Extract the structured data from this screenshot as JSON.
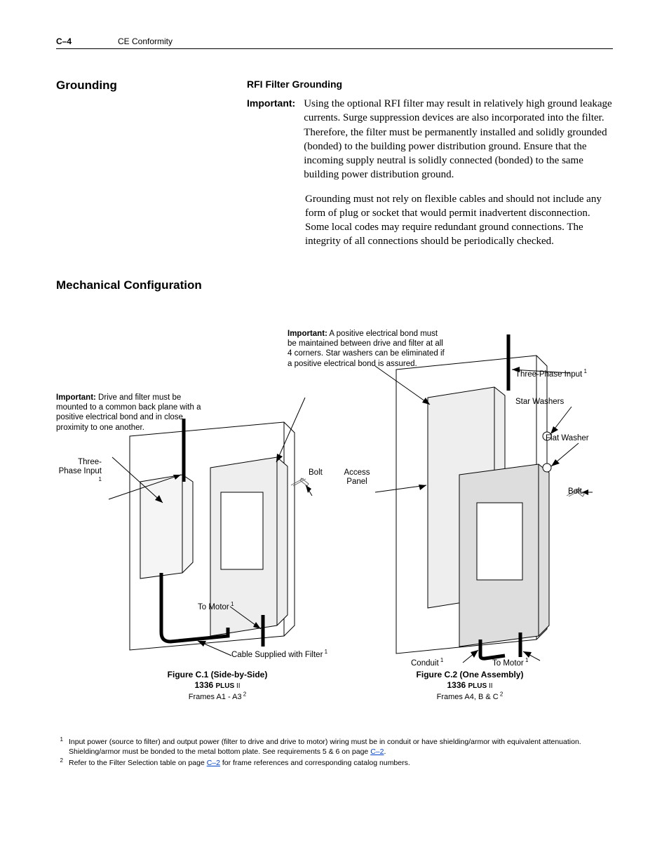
{
  "header": {
    "page_num": "C–4",
    "chapter": "CE Conformity"
  },
  "grounding": {
    "title": "Grounding",
    "subtitle": "RFI Filter Grounding",
    "important_label": "Important:",
    "important_text": "Using the optional RFI filter may result in relatively high ground leakage currents. Surge suppression devices are also incorporated into the filter. Therefore, the filter must be permanently installed and solidly grounded (bonded) to the building power distribution ground. Ensure that the incoming supply neutral is solidly connected (bonded) to the same building power distribution ground.",
    "para2": "Grounding must not rely on flexible cables and should not include any form of plug or socket that would permit inadvertent disconnection. Some local codes may require redundant ground connections. The integrity of all connections should be periodically checked."
  },
  "mechanical": {
    "title": "Mechanical Configuration",
    "note_left_label": "Important:",
    "note_left_text": " Drive and filter must be mounted to a common back plane with a positive electrical bond and in close proximity to one another.",
    "note_top_label": "Important:",
    "note_top_text": " A positive electrical bond must be maintained between drive and filter at all 4 corners. Star washers can be eliminated if a positive electrical bond is assured.",
    "labels": {
      "three_phase_left": "Three-Phase Input",
      "bolt_left": "Bolt",
      "to_motor_left": "To Motor",
      "cable_supplied": "Cable Supplied with Filter",
      "access_panel": "Access Panel",
      "three_phase_right": "Three-Phase Input",
      "star_washers": "Star Washers",
      "flat_washer": "Flat Washer",
      "bolt_right": "Bolt",
      "conduit": "Conduit",
      "to_motor_right": "To Motor"
    },
    "fig1": {
      "line1": "Figure C.1 (Side-by-Side)",
      "line2a": "1336 ",
      "line2b": "PLUS",
      "line2c": " II",
      "line3": "Frames A1 - A3"
    },
    "fig2": {
      "line1": "Figure C.2 (One Assembly)",
      "line2a": "1336 ",
      "line2b": "PLUS",
      "line2c": " II",
      "line3": "Frames A4, B & C"
    }
  },
  "footnotes": {
    "f1_mark": "1",
    "f1_text_a": "Input power (source to filter) and output power (filter to drive and drive to motor) wiring must be in conduit or have shielding/armor with equivalent attenuation. Shielding/armor must be bonded to the metal bottom plate. See requirements 5 & 6 on page ",
    "f1_link": "C–2",
    "f1_text_b": ".",
    "f2_mark": "2",
    "f2_text_a": "Refer to the Filter Selection table on page ",
    "f2_link": "C–2",
    "f2_text_b": " for frame references and corresponding catalog numbers."
  }
}
